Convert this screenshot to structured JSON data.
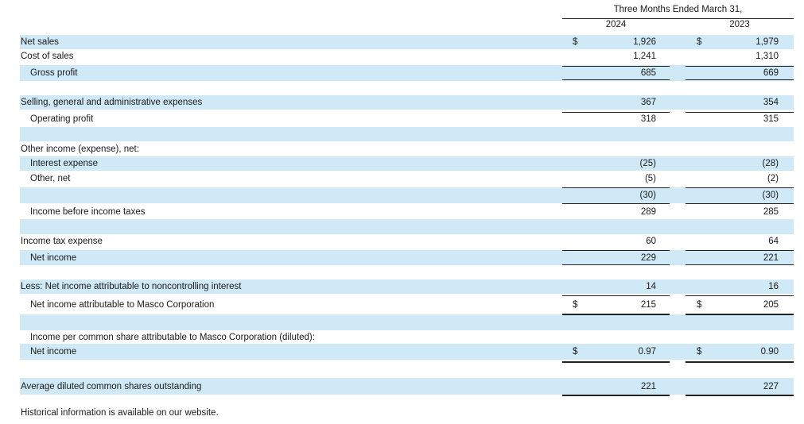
{
  "header": {
    "period": "Three Months Ended March 31,",
    "years": [
      "2024",
      "2023"
    ]
  },
  "rows": [
    {
      "label": "Net sales",
      "indent": false,
      "band": true,
      "c1": "$",
      "v1": "1,926",
      "c2": "$",
      "v2": "1,979"
    },
    {
      "label": "Cost of sales",
      "indent": false,
      "band": false,
      "c1": "",
      "v1": "1,241",
      "c2": "",
      "v2": "1,310"
    },
    {
      "label": "Gross profit",
      "indent": true,
      "band": true,
      "c1": "",
      "v1": "685",
      "c2": "",
      "v2": "669"
    },
    {
      "label": "",
      "indent": false,
      "band": false,
      "c1": "",
      "v1": "",
      "c2": "",
      "v2": ""
    },
    {
      "label": "Selling, general and administrative expenses",
      "indent": false,
      "band": true,
      "c1": "",
      "v1": "367",
      "c2": "",
      "v2": "354"
    },
    {
      "label": "Operating profit",
      "indent": true,
      "band": false,
      "c1": "",
      "v1": "318",
      "c2": "",
      "v2": "315"
    },
    {
      "label": "",
      "indent": false,
      "band": true,
      "c1": "",
      "v1": "",
      "c2": "",
      "v2": ""
    },
    {
      "label": "Other income (expense), net:",
      "indent": false,
      "band": false,
      "c1": "",
      "v1": "",
      "c2": "",
      "v2": ""
    },
    {
      "label": "Interest expense",
      "indent": true,
      "band": true,
      "c1": "",
      "v1": "(25)",
      "c2": "",
      "v2": "(28)"
    },
    {
      "label": "Other, net",
      "indent": true,
      "band": false,
      "c1": "",
      "v1": "(5)",
      "c2": "",
      "v2": "(2)"
    },
    {
      "label": "",
      "indent": false,
      "band": true,
      "c1": "",
      "v1": "(30)",
      "c2": "",
      "v2": "(30)"
    },
    {
      "label": "Income before income taxes",
      "indent": true,
      "band": false,
      "c1": "",
      "v1": "289",
      "c2": "",
      "v2": "285"
    },
    {
      "label": "",
      "indent": false,
      "band": true,
      "c1": "",
      "v1": "",
      "c2": "",
      "v2": ""
    },
    {
      "label": "Income tax expense",
      "indent": false,
      "band": false,
      "c1": "",
      "v1": "60",
      "c2": "",
      "v2": "64"
    },
    {
      "label": "Net income",
      "indent": true,
      "band": true,
      "c1": "",
      "v1": "229",
      "c2": "",
      "v2": "221"
    },
    {
      "label": "",
      "indent": false,
      "band": false,
      "c1": "",
      "v1": "",
      "c2": "",
      "v2": ""
    },
    {
      "label": "Less: Net income attributable to noncontrolling interest",
      "indent": false,
      "band": true,
      "c1": "",
      "v1": "14",
      "c2": "",
      "v2": "16"
    },
    {
      "label": "Net income attributable to Masco Corporation",
      "indent": true,
      "band": false,
      "c1": "$",
      "v1": "215",
      "c2": "$",
      "v2": "205"
    },
    {
      "label": "",
      "indent": false,
      "band": true,
      "c1": "",
      "v1": "",
      "c2": "",
      "v2": ""
    },
    {
      "label": "Income per common share attributable to Masco Corporation (diluted):",
      "indent": true,
      "band": false,
      "c1": "",
      "v1": "",
      "c2": "",
      "v2": ""
    },
    {
      "label": "Net income",
      "indent": true,
      "band": true,
      "c1": "$",
      "v1": "0.97",
      "c2": "$",
      "v2": "0.90"
    },
    {
      "label": "",
      "indent": false,
      "band": false,
      "c1": "",
      "v1": "",
      "c2": "",
      "v2": ""
    },
    {
      "label": "Average diluted common shares outstanding",
      "indent": false,
      "band": true,
      "c1": "",
      "v1": "221",
      "c2": "",
      "v2": "227"
    }
  ],
  "footnote": "Historical information is available on our website."
}
